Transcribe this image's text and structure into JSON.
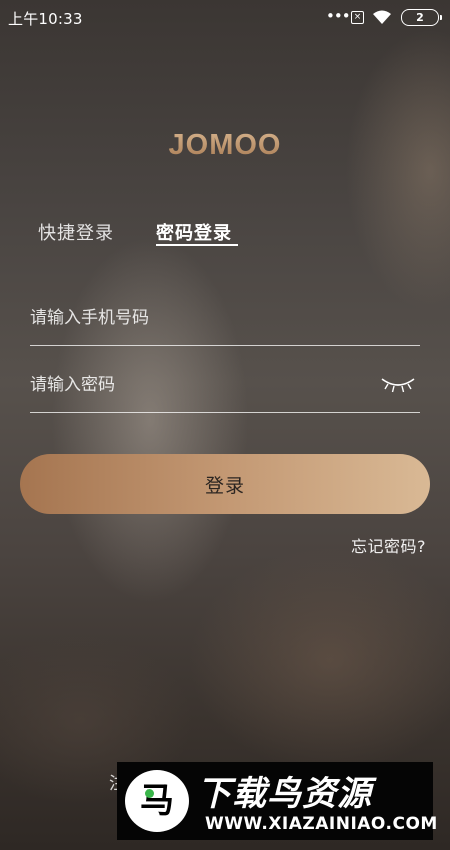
{
  "status_bar": {
    "time": "上午10:33",
    "dots": "•••",
    "sim_glyph": "×",
    "battery": "2"
  },
  "logo": "JOMOO",
  "tabs": {
    "quick": "快捷登录",
    "password": "密码登录",
    "active": "password"
  },
  "form": {
    "phone_placeholder": "请输入手机号码",
    "phone_value": "",
    "password_placeholder": "请输入密码",
    "password_value": ""
  },
  "login_label": "登录",
  "forgot_label": "忘记密码?",
  "register_partial": "注",
  "watermark": {
    "badge_glyph": "马",
    "title": "下载鸟资源",
    "url": "WWW.XIAZAINIAO.COM"
  },
  "colors": {
    "accent_start": "#a57550",
    "accent_end": "#d9b995",
    "logo": "#c39a72"
  },
  "icons": {
    "password_toggle": "eye-closed-icon",
    "wifi": "wifi-icon",
    "battery": "battery-icon"
  }
}
